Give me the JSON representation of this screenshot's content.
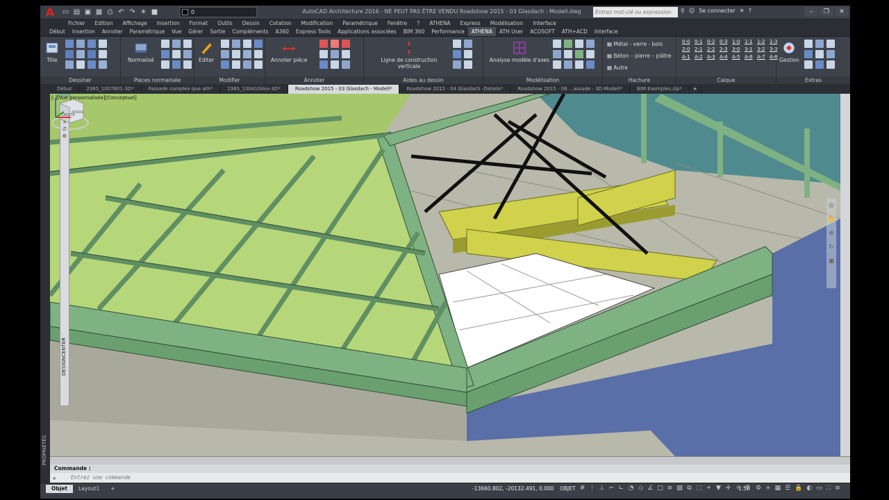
{
  "titlebar": {
    "app_title": "AutoCAD Architecture 2016 - NE PEUT PAS ÊTRE VENDU    Roadshow 2015 - 03 Glasdach - Modell.dwg",
    "layer_value": "0",
    "search_placeholder": "Entrez mot-clé ou expression",
    "connect_label": "Se connecter",
    "logo_letter": "A"
  },
  "menubar": [
    "Fichier",
    "Edition",
    "Affichage",
    "Insertion",
    "Format",
    "Outils",
    "Dessin",
    "Cotation",
    "Modification",
    "Paramétrique",
    "Fenêtre",
    "?",
    "ATHENA",
    "Express",
    "Modélisation",
    "Interface"
  ],
  "ribbon_tabs": [
    {
      "label": "Début",
      "active": false
    },
    {
      "label": "Insertion",
      "active": false
    },
    {
      "label": "Annoter",
      "active": false
    },
    {
      "label": "Paramétrique",
      "active": false
    },
    {
      "label": "Vue",
      "active": false
    },
    {
      "label": "Gérer",
      "active": false
    },
    {
      "label": "Sortie",
      "active": false
    },
    {
      "label": "Compléments",
      "active": false
    },
    {
      "label": "A360",
      "active": false
    },
    {
      "label": "Express Tools",
      "active": false
    },
    {
      "label": "Applications associées",
      "active": false
    },
    {
      "label": "BIM 360",
      "active": false
    },
    {
      "label": "Performance",
      "active": false
    },
    {
      "label": "ATHENA",
      "active": true
    },
    {
      "label": "ATH User",
      "active": false
    },
    {
      "label": "ACOSOFT",
      "active": false
    },
    {
      "label": "ATH+ACD",
      "active": false
    },
    {
      "label": "Interface",
      "active": false
    }
  ],
  "ribbon": {
    "panels": {
      "dessiner": "Dessiner",
      "pieces": "Pieces normalisée",
      "modifier": "Modifier",
      "annoter": "Annoter",
      "aides": "Aides au dessin",
      "modelisation": "Modélisation",
      "hachure": "Hachure",
      "calque": "Calque",
      "extras": "Extras"
    },
    "buttons": {
      "tole": "Tôle",
      "normalise": "Normalisé",
      "editer": "Editer",
      "annoter_piece": "Annoter pièce",
      "ligne_construction": "Ligne de construction verticale",
      "analyse": "Analyse modèle d'axes",
      "gestion": "Gestion"
    },
    "hachure_items": [
      "Métal - verre - bois",
      "Béton – pierre – plâtre",
      "Autre"
    ],
    "calque_labels": [
      "0-0",
      "0-1",
      "0-2",
      "0-3",
      "1-0",
      "1-1",
      "1-2",
      "1-3",
      "2-0",
      "2-1",
      "2-2",
      "2-3",
      "3-0",
      "3-1",
      "3-2",
      "3-3",
      "A-1",
      "A-2",
      "A-3",
      "A-4",
      "A-5",
      "A-6",
      "A-7",
      "A-8"
    ]
  },
  "doc_tabs": [
    {
      "label": "Début",
      "active": false
    },
    {
      "label": "2365_1007601-3D*",
      "active": false
    },
    {
      "label": "Fassade complex que ath*",
      "active": false
    },
    {
      "label": "2365_1004104xx-3D*",
      "active": false
    },
    {
      "label": "Roadshow 2015 - 03 Glasdach - Modell*",
      "active": true
    },
    {
      "label": "Roadshow 2015 - 04 Glasdach -Details*",
      "active": false
    },
    {
      "label": "Roadshow 2015 - 06 ...assade - 3D-Modell*",
      "active": false
    },
    {
      "label": "BIM Exemples.zip*",
      "active": false
    }
  ],
  "viewport": {
    "label": "[-][Vue personnalisée][Conceptuel]",
    "designcenter": "DESIGNCENTER",
    "viewcube_face": "DROITE",
    "viewcube_face2": "ARRIÈRE"
  },
  "left_strip": "PROPRIÉTÉS",
  "command": {
    "prompt": "Commande :",
    "placeholder": "Entrez une commande"
  },
  "status": {
    "layout_tabs": [
      {
        "label": "Objet",
        "active": true
      },
      {
        "label": "Layout1",
        "active": false
      }
    ],
    "coords": "-13660.802, -20132.491, 0.000",
    "mode": "OBJET",
    "scale": "1:50"
  },
  "colors": {
    "glass": "#b6d67a",
    "frame": "#7fb283",
    "beam": "#cfd24a",
    "wall_blue": "#5a6fa8",
    "floor": "#b7b7a8"
  }
}
